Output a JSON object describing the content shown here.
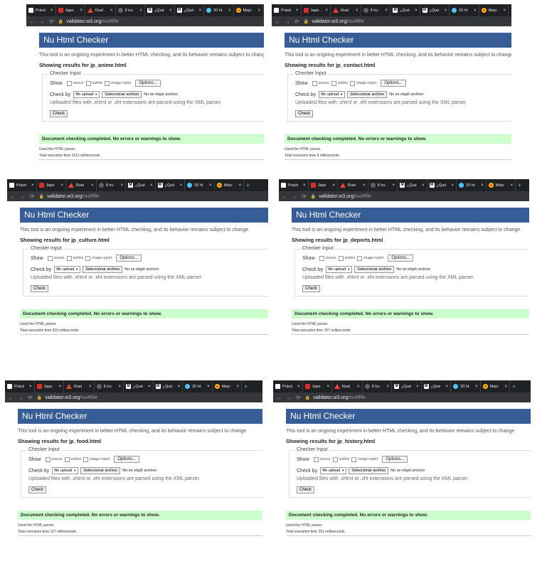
{
  "tabs": [
    {
      "label": "Prácti",
      "icon": "github-icon"
    },
    {
      "label": "Japo",
      "icon": "flag-icon"
    },
    {
      "label": "Ruel",
      "icon": "triangle-logo-icon"
    },
    {
      "label": "8 tru",
      "icon": "dark-circle-icon"
    },
    {
      "label": "¿Qué",
      "icon": "medium-icon"
    },
    {
      "label": "¿Qué",
      "icon": "medium-icon"
    },
    {
      "label": "20 ht",
      "icon": "globe-icon"
    },
    {
      "label": "Mejo",
      "icon": "chrome-icon"
    }
  ],
  "browser": {
    "url_host": "validator.w3.org",
    "url_path": "/nu/#file",
    "close_glyph": "×",
    "new_tab_glyph": "+"
  },
  "checker": {
    "title": "Nu Html Checker",
    "intro": "This tool is an ongoing experiment in better HTML checking, and its behavior remains subject to change",
    "legend": "Checker Input",
    "show_label": "Show",
    "opt_source": "source",
    "opt_outline": "outline",
    "opt_image_report": "image report",
    "options_button": "Options...",
    "check_by_label": "Check by",
    "check_by_value": "file upload",
    "choose_file_button": "Seleccionar archivo",
    "no_file_text": "No se eligió archivo",
    "xml_note": "Uploaded files with .xhtml or .xht extensions are parsed using the XML parser.",
    "check_button": "Check",
    "success_message": "Document checking completed. No errors or warnings to show.",
    "used_parser": "Used the HTML parser."
  },
  "results": [
    {
      "showing": "Showing results for jp_anime.html",
      "exec": "Total execution time 1512 milliseconds"
    },
    {
      "showing": "Showing results for jp_contact.html",
      "exec": "Total execution time 9 milliseconds"
    },
    {
      "showing": "Showing results for jp_culture.html",
      "exec": "Total execution time 910 milliseconds"
    },
    {
      "showing": "Showing results for jp_deports.html",
      "exec": "Total execution time 107 milliseconds"
    },
    {
      "showing": "Showing results for jp_food.html",
      "exec": "Total execution time 117 milliseconds"
    },
    {
      "showing": "Showing results for jp_history.html",
      "exec": "Total execution time 351 milliseconds"
    }
  ]
}
